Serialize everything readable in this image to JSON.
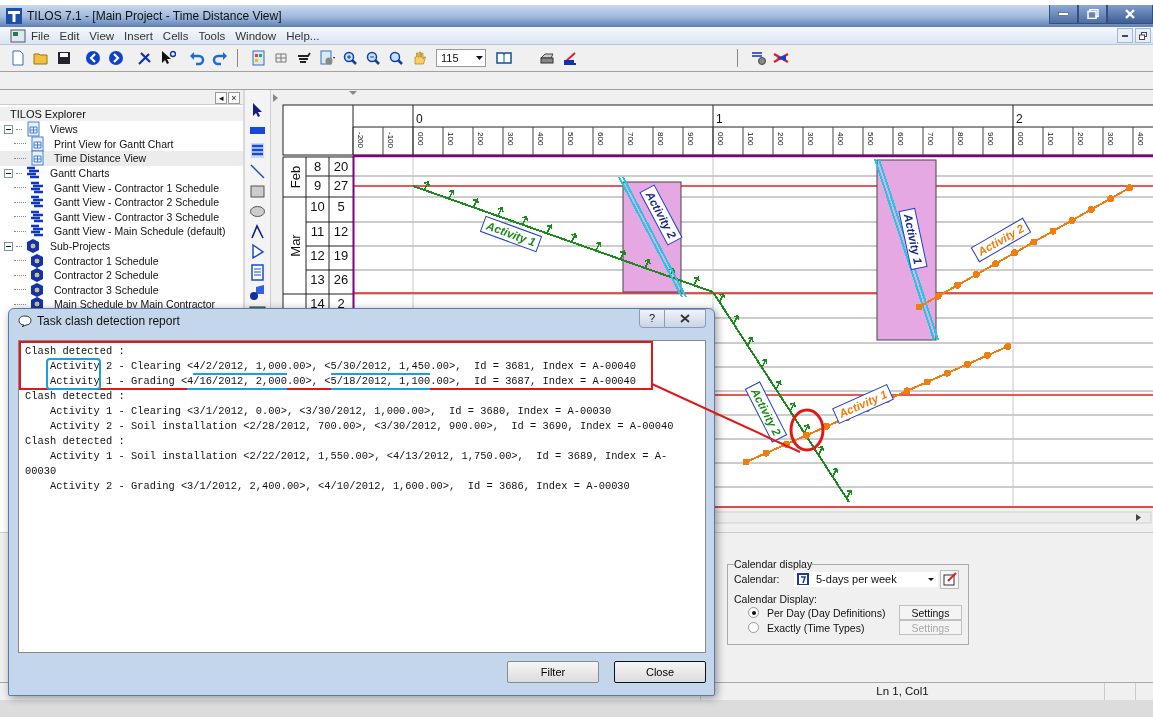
{
  "window": {
    "title": "TILOS 7.1  - [Main Project -  Time Distance View]"
  },
  "menu": [
    "File",
    "Edit",
    "View",
    "Insert",
    "Cells",
    "Tools",
    "Window",
    "Help..."
  ],
  "toolbar": {
    "zoom": "115"
  },
  "explorer": {
    "pane_buttons": [
      "◂",
      "×"
    ],
    "title": "TILOS Explorer",
    "tree": [
      {
        "label": "Views",
        "kind": "views",
        "expanded": true,
        "selected": false,
        "children": [
          {
            "label": "Print View for Gantt Chart",
            "kind": "views",
            "selected": false
          },
          {
            "label": "Time Distance View",
            "kind": "views",
            "selected": true
          }
        ]
      },
      {
        "label": "Gantt Charts",
        "kind": "gantt",
        "expanded": true,
        "selected": false,
        "children": [
          {
            "label": "Gantt View - Contractor 1 Schedule",
            "kind": "gantt",
            "selected": false
          },
          {
            "label": "Gantt View - Contractor 2 Schedule",
            "kind": "gantt",
            "selected": false
          },
          {
            "label": "Gantt View - Contractor 3 Schedule",
            "kind": "gantt",
            "selected": false
          },
          {
            "label": "Gantt View - Main Schedule (default)",
            "kind": "gantt",
            "selected": false
          }
        ]
      },
      {
        "label": "Sub-Projects",
        "kind": "project",
        "expanded": true,
        "selected": false,
        "children": [
          {
            "label": "Contractor 1 Schedule",
            "kind": "project",
            "selected": false
          },
          {
            "label": "Contractor 2 Schedule",
            "kind": "project",
            "selected": false
          },
          {
            "label": "Contractor 3 Schedule",
            "kind": "project",
            "selected": false
          },
          {
            "label": "Main Schedule by Main Contractor",
            "kind": "project",
            "selected": false
          }
        ]
      }
    ]
  },
  "chart": {
    "distance_labels": [
      "0",
      "1",
      "2"
    ],
    "tick_labels": [
      "-200",
      "-100",
      "000",
      "100",
      "200",
      "300",
      "400",
      "500",
      "600",
      "700",
      "800",
      "900",
      "000",
      "100",
      "200",
      "300",
      "400",
      "500",
      "600",
      "700",
      "800",
      "900",
      "000",
      "100",
      "200",
      "300",
      "400"
    ],
    "months": [
      {
        "label": "Feb",
        "weeks": [
          {
            "week": "8",
            "day": "20"
          },
          {
            "week": "9",
            "day": "27"
          }
        ]
      },
      {
        "label": "Mar",
        "weeks": [
          {
            "week": "10",
            "day": "5"
          },
          {
            "week": "11",
            "day": "12"
          },
          {
            "week": "12",
            "day": "19"
          },
          {
            "week": "13",
            "day": "26"
          }
        ]
      },
      {
        "weeks": [
          {
            "week": "14",
            "day": "2"
          }
        ]
      }
    ],
    "activities": [
      {
        "label": "Activity 1",
        "kind": "arrows",
        "color": "#1c8a1c"
      },
      {
        "label": "Activity 2",
        "kind": "double",
        "color": "#22c8e0"
      },
      {
        "label": "Activity 1",
        "kind": "double",
        "color": "#22c8e0"
      },
      {
        "label": "Activity 2",
        "kind": "dots",
        "color": "#f07d10"
      },
      {
        "label": "Activity 2",
        "kind": "arrows",
        "color": "#1c8a1c"
      },
      {
        "label": "Activity 1",
        "kind": "dots",
        "color": "#f07d10"
      }
    ]
  },
  "calendar_display": {
    "title": "Calendar display",
    "calendar_label": "Calendar:",
    "calendar_value": "5-days per week",
    "display_label": "Calendar Display:",
    "options": [
      {
        "label": "Per Day (Day Definitions)",
        "selected": true,
        "button": "Settings",
        "button_disabled": false
      },
      {
        "label": "Exactly (Time Types)",
        "selected": false,
        "button": "Settings",
        "button_disabled": true
      }
    ]
  },
  "status_bar": {
    "position": "Ln 1, Col1"
  },
  "dialog": {
    "title": "Task clash detection report",
    "help_button": "?",
    "lines": [
      "Clash detected :",
      "    Activity 2 - Clearing <4/2/2012, 1,000.00>, <5/30/2012, 1,450.00>,  Id = 3681, Index = A-00040",
      "    Activity 1 - Grading <4/16/2012, 2,000.00>, <5/18/2012, 1,100.00>,  Id = 3687, Index = A-00040",
      "Clash detected :",
      "    Activity 1 - Clearing <3/1/2012, 0.00>, <3/30/2012, 1,000.00>,  Id = 3680, Index = A-00030",
      "    Activity 2 - Soil installation <2/28/2012, 700.00>, <3/30/2012, 900.00>,  Id = 3690, Index = A-00040",
      "Clash detected :",
      "    Activity 1 - Soil installation <2/22/2012, 1,550.00>, <4/13/2012, 1,750.00>,  Id = 3689, Index = A-",
      "00030",
      "    Activity 2 - Grading <3/1/2012, 2,400.00>, <4/10/2012, 1,600.00>,  Id = 3686, Index = A-00030"
    ],
    "buttons": [
      {
        "label": "Filter",
        "default": false
      },
      {
        "label": "Close",
        "default": true
      }
    ]
  }
}
